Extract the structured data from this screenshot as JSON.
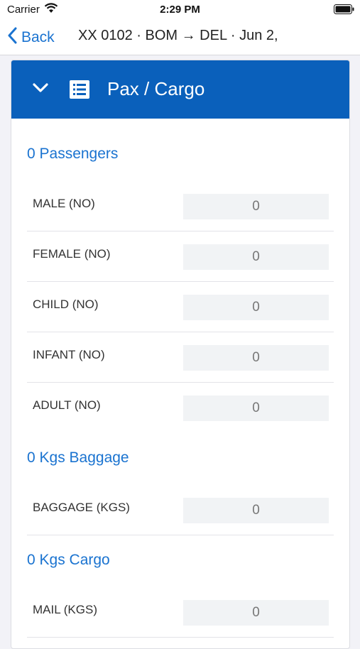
{
  "status_bar": {
    "carrier": "Carrier",
    "time": "2:29 PM",
    "icons": [
      "wifi-icon",
      "battery-icon"
    ]
  },
  "nav": {
    "back_label": "Back",
    "title": "XX 0102 · BOM → DEL · Jun 2,"
  },
  "panel": {
    "title": "Pax / Cargo",
    "header_color": "#0a60bb",
    "icons": [
      "chevron-down-icon",
      "list-icon"
    ]
  },
  "sections": {
    "passengers": {
      "title": "0 Passengers",
      "rows": [
        {
          "label": "MALE (NO)",
          "value": "0"
        },
        {
          "label": "FEMALE (NO)",
          "value": "0"
        },
        {
          "label": "CHILD (NO)",
          "value": "0"
        },
        {
          "label": "INFANT (NO)",
          "value": "0"
        },
        {
          "label": "ADULT (NO)",
          "value": "0"
        }
      ]
    },
    "baggage": {
      "title": "0 Kgs Baggage",
      "rows": [
        {
          "label": "BAGGAGE (KGS)",
          "value": "0"
        }
      ]
    },
    "cargo": {
      "title": "0 Kgs Cargo",
      "rows": [
        {
          "label": "MAIL (KGS)",
          "value": "0"
        }
      ]
    }
  },
  "colors": {
    "accent": "#1a73d0",
    "header": "#0a60bb",
    "field_bg": "#f1f3f5"
  }
}
